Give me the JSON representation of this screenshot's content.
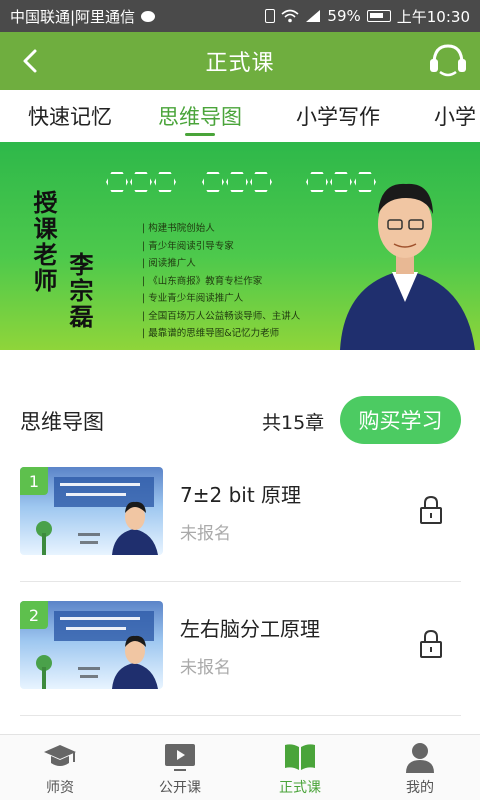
{
  "statusbar": {
    "carrier": "中国联通|阿里通信",
    "battery": "59%",
    "time": "上午10:30"
  },
  "header": {
    "title": "正式课"
  },
  "tabs": [
    {
      "label": "快速记忆"
    },
    {
      "label": "思维导图"
    },
    {
      "label": "小学写作"
    },
    {
      "label": "小学"
    }
  ],
  "banner": {
    "role": "授课老师",
    "teacher_name": "李宗磊",
    "credentials": [
      "构建书院创始人",
      "青少年阅读引导专家",
      "阅读推广人",
      "《山东商报》教育专栏作家",
      "专业青少年阅读推广人",
      "全国百场万人公益畅谈导师、主讲人",
      "最靠谱的思维导图&记忆力老师"
    ]
  },
  "section": {
    "title": "思维导图",
    "chapters": "共15章",
    "buy_label": "购买学习"
  },
  "lessons": [
    {
      "index": "1",
      "title": "7±2 bit 原理",
      "status": "未报名"
    },
    {
      "index": "2",
      "title": "左右脑分工原理",
      "status": "未报名"
    }
  ],
  "bottomnav": [
    {
      "label": "师资",
      "icon": "graduation-cap-icon"
    },
    {
      "label": "公开课",
      "icon": "video-play-icon"
    },
    {
      "label": "正式课",
      "icon": "open-book-icon"
    },
    {
      "label": "我的",
      "icon": "person-icon"
    }
  ],
  "colors": {
    "header": "#6fae3f",
    "accent": "#4aa43a",
    "buy_button": "#4ccb62"
  }
}
